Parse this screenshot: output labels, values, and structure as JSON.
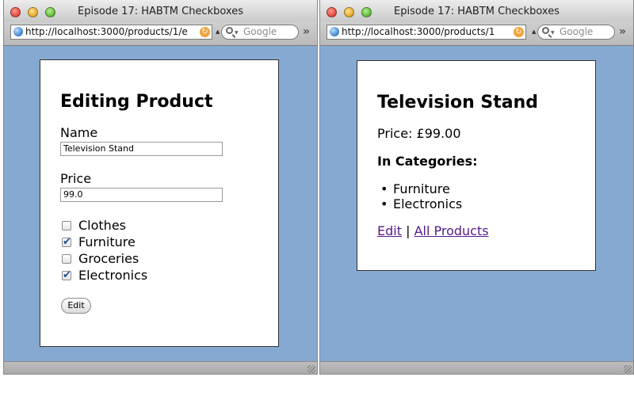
{
  "left_window": {
    "title": "Episode 17: HABTM Checkboxes",
    "url": "http://localhost:3000/products/1/e",
    "search_placeholder": "Google",
    "heading": "Editing Product",
    "name_label": "Name",
    "name_value": "Television Stand",
    "price_label": "Price",
    "price_value": "99.0",
    "categories": [
      {
        "label": "Clothes",
        "checked": false
      },
      {
        "label": "Furniture",
        "checked": true
      },
      {
        "label": "Groceries",
        "checked": false
      },
      {
        "label": "Electronics",
        "checked": true
      }
    ],
    "submit_label": "Edit"
  },
  "right_window": {
    "title": "Episode 17: HABTM Checkboxes",
    "url": "http://localhost:3000/products/1",
    "search_placeholder": "Google",
    "heading": "Television Stand",
    "price_label": "Price:",
    "price_value": "£99.00",
    "categories_heading": "In Categories:",
    "categories": [
      "Furniture",
      "Electronics"
    ],
    "edit_link": "Edit",
    "separator": "|",
    "all_products_link": "All Products"
  },
  "icons": {
    "checkmark": "✔",
    "reload": "↻",
    "overflow": "»"
  },
  "colors": {
    "page_background": "#86a9d1",
    "visited_link": "#551a8b"
  }
}
